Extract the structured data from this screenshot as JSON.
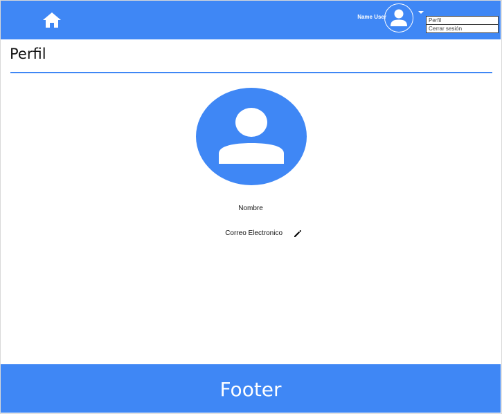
{
  "header": {
    "user_name": "Name User",
    "menu": {
      "items": [
        {
          "label": "Perfil"
        },
        {
          "label": "Cerrar sesión"
        }
      ]
    }
  },
  "main": {
    "title": "Perfil",
    "fields": {
      "name_label": "Nombre",
      "email_label": "Correo Electronico"
    }
  },
  "footer": {
    "text": "Footer"
  },
  "icons": {
    "home": "home-icon",
    "avatar": "user-avatar-icon",
    "caret": "caret-down-icon",
    "edit": "pencil-icon"
  },
  "colors": {
    "brand": "#3f87f5",
    "text_on_brand": "#ffffff",
    "border": "#333333"
  }
}
